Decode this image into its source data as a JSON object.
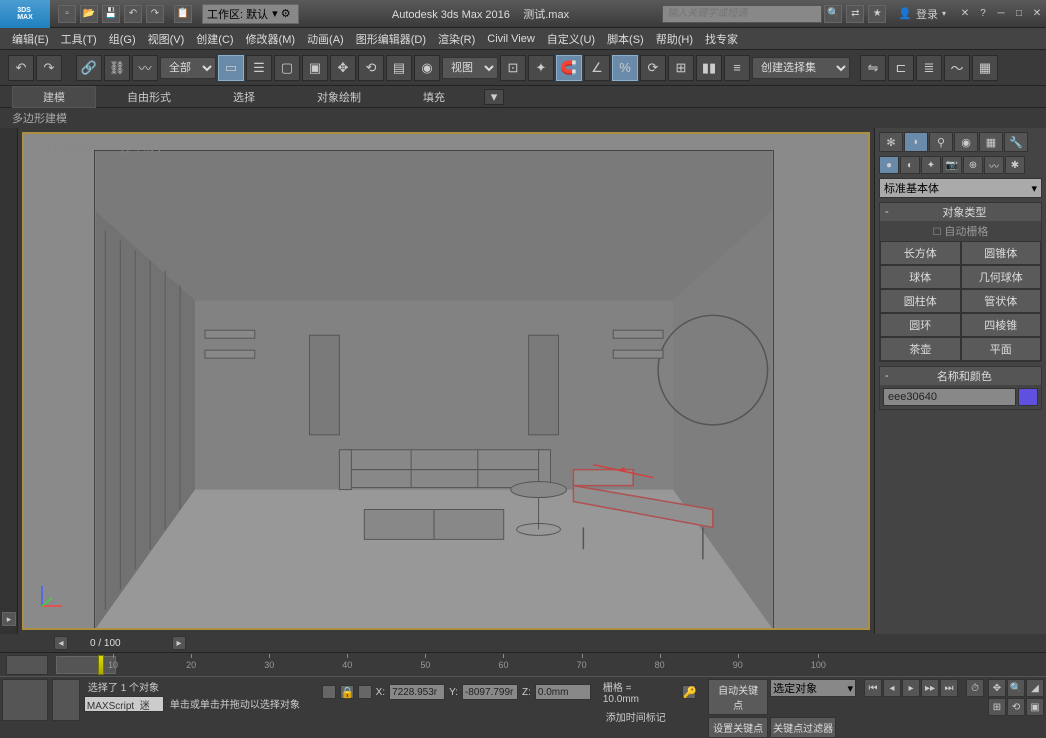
{
  "titlebar": {
    "workspace_label": "工作区: 默认",
    "app_title": "Autodesk 3ds Max 2016",
    "file_name": "测试.max",
    "search_placeholder": "输入关键字或短语",
    "login_label": "登录"
  },
  "menus": [
    "编辑(E)",
    "工具(T)",
    "组(G)",
    "视图(V)",
    "创建(C)",
    "修改器(M)",
    "动画(A)",
    "图形编辑器(D)",
    "渲染(R)",
    "Civil View",
    "自定义(U)",
    "脚本(S)",
    "帮助(H)",
    "找专家"
  ],
  "toolbar": {
    "filter_label": "全部",
    "snap_label": "视图",
    "selection_set": "创建选择集"
  },
  "ribbon": {
    "tabs": [
      "建模",
      "自由形式",
      "选择",
      "对象绘制",
      "填充"
    ],
    "subtab": "多边形建模"
  },
  "viewport": {
    "label": "[ + ] [ Camera003 ] [ 平滑 ]"
  },
  "cmdpanel": {
    "dropdown": "标准基本体",
    "rollout_type": "对象类型",
    "auto_grid": "自动栅格",
    "primitives": [
      [
        "长方体",
        "圆锥体"
      ],
      [
        "球体",
        "几何球体"
      ],
      [
        "圆柱体",
        "管状体"
      ],
      [
        "圆环",
        "四棱锥"
      ],
      [
        "茶壶",
        "平面"
      ]
    ],
    "rollout_name": "名称和颜色",
    "obj_name": "eee30640"
  },
  "timeline": {
    "frame_display": "0 / 100",
    "ticks": [
      "10",
      "20",
      "30",
      "40",
      "50",
      "60",
      "70",
      "80",
      "90",
      "100"
    ]
  },
  "status": {
    "selection": "选择了 1 个对象",
    "prompt": "单击或单击并拖动以选择对象",
    "coords": {
      "x": "7228.953r",
      "y": "-8097.799r",
      "z": "0.0mm"
    },
    "grid": "栅格 = 10.0mm",
    "auto_key": "自动关键点",
    "sel_obj": "选定对象",
    "set_key": "设置关键点",
    "key_filter": "关键点过滤器",
    "maxscript": "MAXScript  迷",
    "add_time": "添加时间标记"
  }
}
